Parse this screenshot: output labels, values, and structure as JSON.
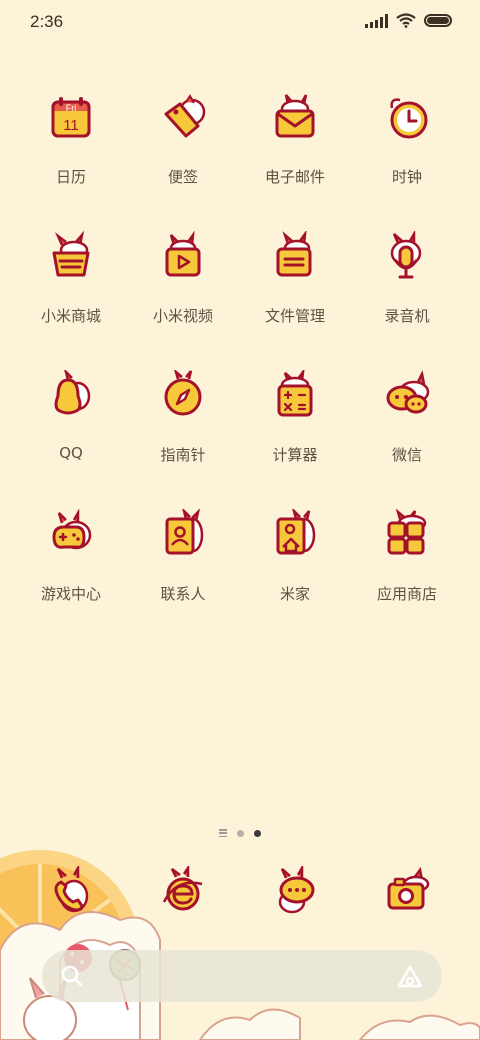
{
  "status_bar": {
    "time": "2:36"
  },
  "apps": [
    {
      "label": "日历",
      "icon": "calendar-icon",
      "day": "Fri",
      "date": "11"
    },
    {
      "label": "便签",
      "icon": "notes-tag-icon"
    },
    {
      "label": "电子邮件",
      "icon": "email-icon"
    },
    {
      "label": "时钟",
      "icon": "clock-icon"
    },
    {
      "label": "小米商城",
      "icon": "mi-store-icon"
    },
    {
      "label": "小米视频",
      "icon": "mi-video-icon"
    },
    {
      "label": "文件管理",
      "icon": "file-manager-icon"
    },
    {
      "label": "录音机",
      "icon": "recorder-icon"
    },
    {
      "label": "QQ",
      "icon": "qq-icon"
    },
    {
      "label": "指南针",
      "icon": "compass-icon"
    },
    {
      "label": "计算器",
      "icon": "calculator-icon"
    },
    {
      "label": "微信",
      "icon": "wechat-icon"
    },
    {
      "label": "游戏中心",
      "icon": "game-center-icon"
    },
    {
      "label": "联系人",
      "icon": "contacts-icon"
    },
    {
      "label": "米家",
      "icon": "mijia-icon"
    },
    {
      "label": "应用商店",
      "icon": "app-store-icon"
    }
  ],
  "dock": [
    {
      "icon": "phone-icon"
    },
    {
      "icon": "browser-icon"
    },
    {
      "icon": "messages-icon"
    },
    {
      "icon": "camera-icon"
    }
  ],
  "pager": {
    "pages": 2,
    "active": 1
  },
  "colors": {
    "background": "#fdf3d9",
    "icon_fill": "#f7c93a",
    "icon_stroke": "#a3122a"
  }
}
